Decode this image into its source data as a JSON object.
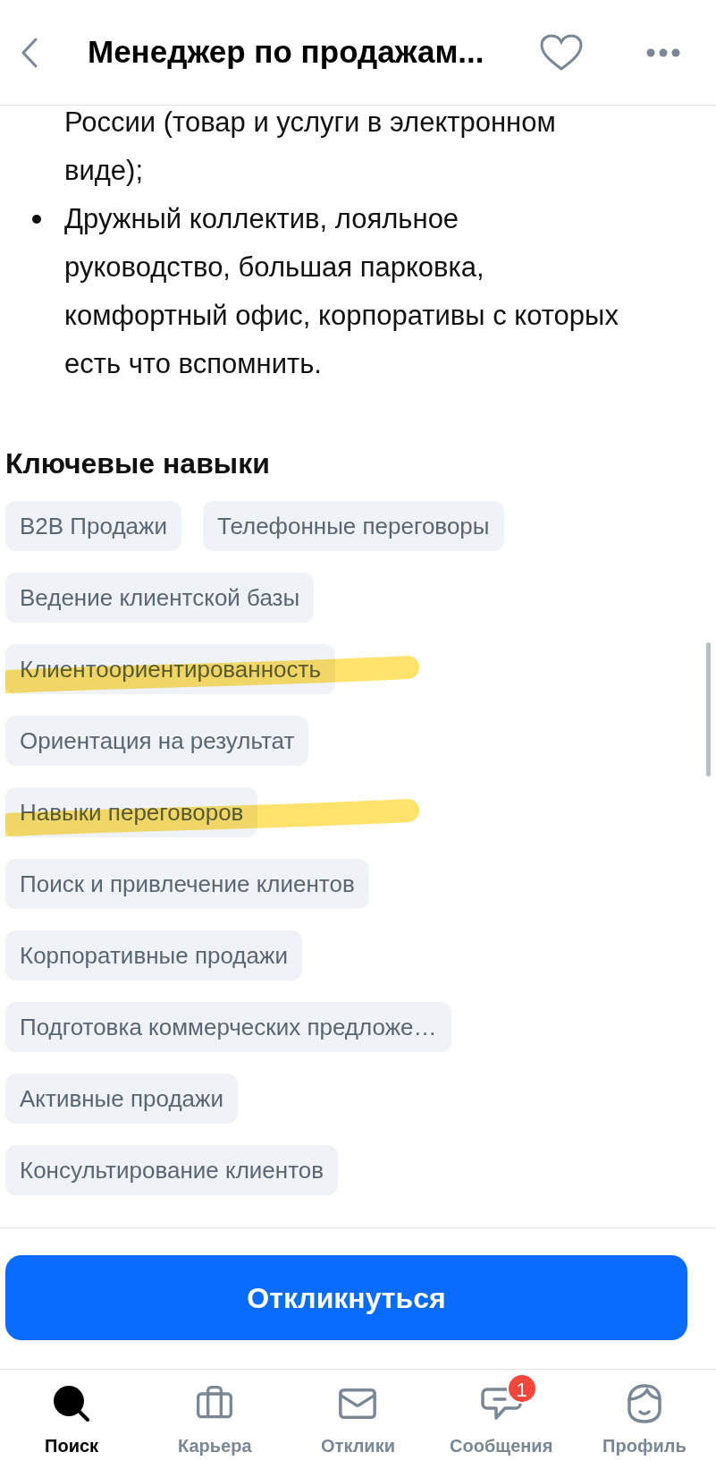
{
  "header": {
    "title": "Менеджер по продажам..."
  },
  "description": {
    "items": [
      {
        "text": "России (товар и услуги в электронном виде);",
        "bullet": false
      },
      {
        "text": "Дружный коллектив, лояльное руководство, большая парковка, комфортный офис, корпоративы с которых есть что вспомнить.",
        "bullet": true
      }
    ]
  },
  "skills": {
    "title": "Ключевые навыки",
    "items": [
      {
        "label": "B2B Продажи",
        "highlighted": false
      },
      {
        "label": "Телефонные переговоры",
        "highlighted": false
      },
      {
        "label": "Ведение клиентской базы",
        "highlighted": false
      },
      {
        "label": "Клиентоориентированность",
        "highlighted": true
      },
      {
        "label": "Ориентация на результат",
        "highlighted": false
      },
      {
        "label": "Навыки переговоров",
        "highlighted": true
      },
      {
        "label": "Поиск и привлечение клиентов",
        "highlighted": false
      },
      {
        "label": "Корпоративные продажи",
        "highlighted": false
      },
      {
        "label": "Подготовка коммерческих предложе…",
        "highlighted": false
      },
      {
        "label": "Активные продажи",
        "highlighted": false
      },
      {
        "label": "Консультирование клиентов",
        "highlighted": false
      }
    ]
  },
  "apply_button": "Откликнуться",
  "tab_bar": [
    {
      "kind": "search",
      "label": "Поиск",
      "selected": true
    },
    {
      "kind": "career",
      "label": "Карьера",
      "selected": false
    },
    {
      "kind": "responses",
      "label": "Отклики",
      "selected": false
    },
    {
      "kind": "messages",
      "label": "Сообщения",
      "selected": false,
      "badge": "1"
    },
    {
      "kind": "profile",
      "label": "Профиль",
      "selected": false
    }
  ]
}
